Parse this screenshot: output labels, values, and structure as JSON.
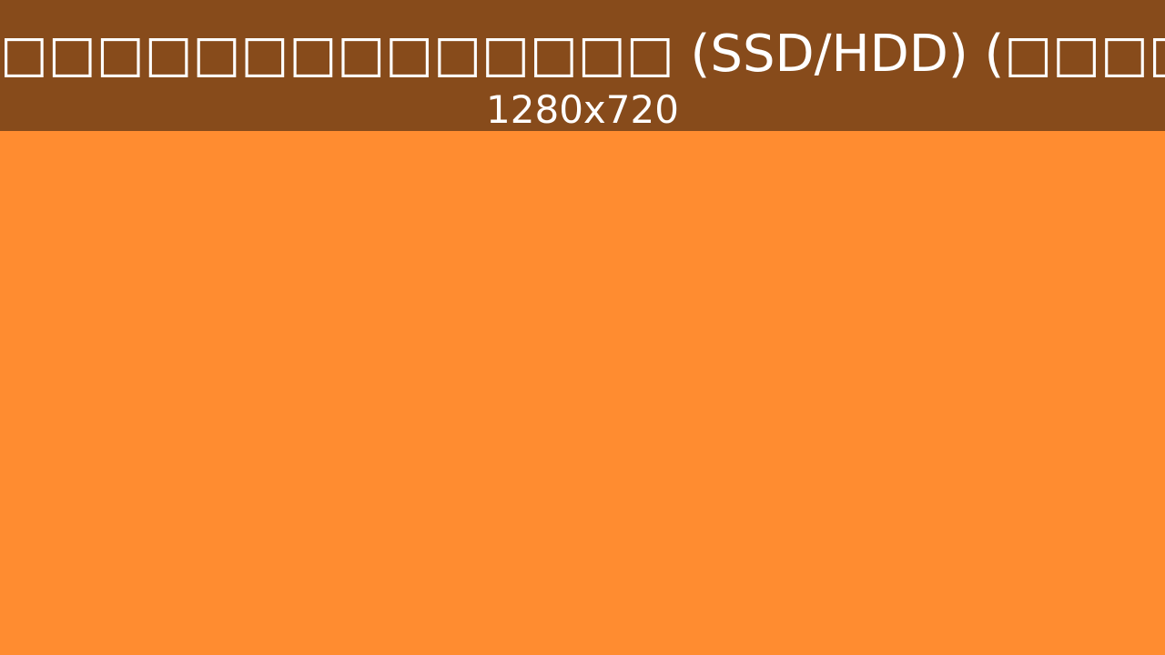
{
  "header": {
    "title": "□□□□□□□□□□□□□□ (SSD/HDD) (□□□□□□□□□□□□)",
    "dimensions": "1280x720"
  },
  "colors": {
    "header_background": "#874b1b",
    "page_background": "#ff8c30",
    "text": "#ffffff"
  }
}
